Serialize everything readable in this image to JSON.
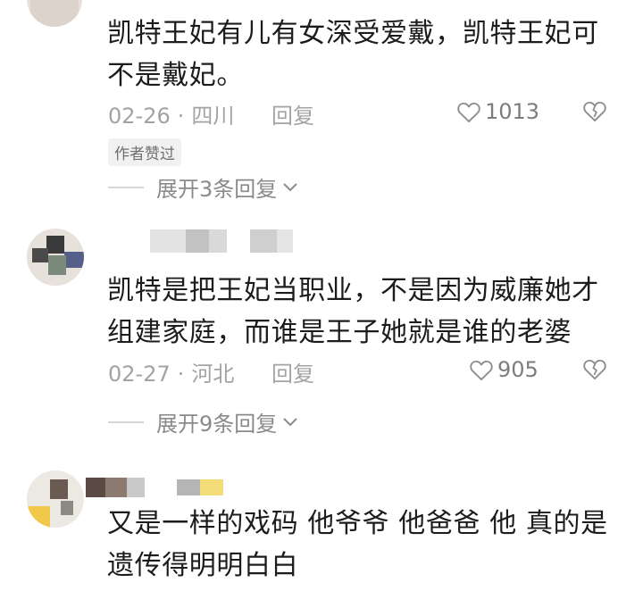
{
  "comments": [
    {
      "text_line1": "凯特王妃有儿有女深受爱戴，凯特王妃可",
      "text_line2": "不是戴妃。",
      "date": "02-26",
      "location": "四川",
      "reply_label": "回复",
      "likes": "1013",
      "badge": "作者赞过",
      "expand_label": "展开3条回复"
    },
    {
      "text_line1": "凯特是把王妃当职业，不是因为威廉她才",
      "text_line2": "组建家庭，而谁是王子她就是谁的老婆",
      "date": "02-27",
      "location": "河北",
      "reply_label": "回复",
      "likes": "905",
      "expand_label": "展开9条回复"
    },
    {
      "text_line1": "又是一样的戏码 他爷爷 他爸爸 他 真的是",
      "text_line2": "遗传得明明白白"
    }
  ],
  "separator": "·",
  "colors": {
    "text": "#1c1c1c",
    "meta": "#a3a3a3",
    "background": "#ffffff"
  },
  "icons": [
    "heart-outline-icon",
    "broken-heart-icon",
    "chevron-down-icon"
  ]
}
